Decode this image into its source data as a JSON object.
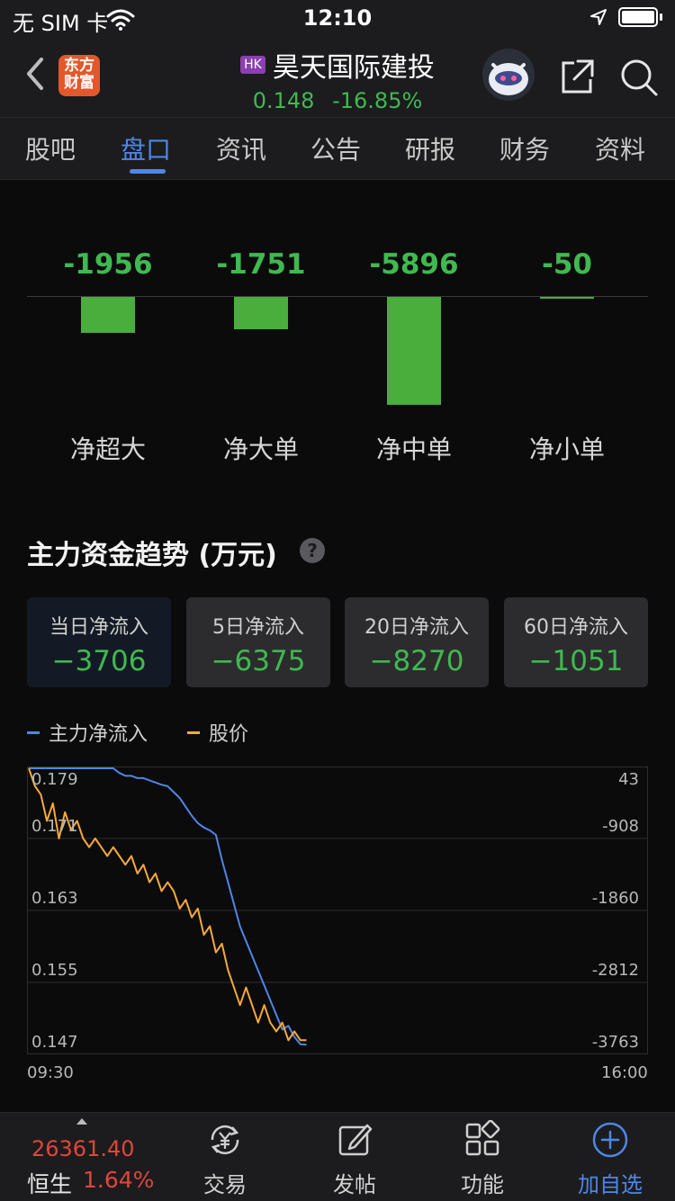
{
  "status_bar": {
    "carrier": "无 SIM 卡",
    "time": "12:10"
  },
  "header": {
    "logo_line1": "东方",
    "logo_line2": "财富",
    "market_badge": "HK",
    "stock_name": "昊天国际建投",
    "price": "0.148",
    "change_pct": "-16.85%"
  },
  "tabs": [
    {
      "label": "股吧"
    },
    {
      "label": "盘口",
      "active": true
    },
    {
      "label": "资讯"
    },
    {
      "label": "公告"
    },
    {
      "label": "研报"
    },
    {
      "label": "财务"
    },
    {
      "label": "资料"
    }
  ],
  "order_flow": {
    "items": [
      {
        "label": "净超大",
        "value": "-1956",
        "num": -1956
      },
      {
        "label": "净大单",
        "value": "-1751",
        "num": -1751
      },
      {
        "label": "净中单",
        "value": "-5896",
        "num": -5896
      },
      {
        "label": "净小单",
        "value": "-50",
        "num": -50
      }
    ]
  },
  "trend": {
    "title": "主力资金趋势 (万元)",
    "help": "?",
    "cards": [
      {
        "label": "当日净流入",
        "value": "−3706",
        "active": true
      },
      {
        "label": "5日净流入",
        "value": "−6375"
      },
      {
        "label": "20日净流入",
        "value": "−8270"
      },
      {
        "label": "60日净流入",
        "value": "−1051"
      }
    ],
    "legend": [
      {
        "label": "主力净流入",
        "color": "#4e86e8"
      },
      {
        "label": "股价",
        "color": "#f5a93b"
      }
    ]
  },
  "chart_data": {
    "type": "line",
    "x_start": "09:30",
    "x_end": "16:00",
    "y_left_ticks": [
      "0.179",
      "0.171",
      "0.163",
      "0.155",
      "0.147"
    ],
    "y_right_ticks": [
      "43",
      "-908",
      "-1860",
      "-2812",
      "-3763"
    ],
    "y_left_range": [
      0.147,
      0.179
    ],
    "y_right_range": [
      -3763,
      43
    ],
    "x_progress_end": 0.45,
    "series": [
      {
        "name": "主力净流入",
        "color": "#4e86e8",
        "axis": "right",
        "values": [
          43,
          43,
          43,
          43,
          43,
          43,
          43,
          43,
          43,
          43,
          43,
          43,
          43,
          43,
          43,
          -20,
          -60,
          -60,
          -90,
          -90,
          -120,
          -150,
          -180,
          -200,
          -280,
          -360,
          -480,
          -600,
          -700,
          -760,
          -800,
          -860,
          -1200,
          -1500,
          -1800,
          -2100,
          -2300,
          -2500,
          -2700,
          -2900,
          -3100,
          -3300,
          -3500,
          -3450,
          -3600,
          -3700,
          -3706
        ]
      },
      {
        "name": "股价",
        "color": "#f5a93b",
        "axis": "left",
        "values": [
          0.179,
          0.177,
          0.176,
          0.173,
          0.175,
          0.171,
          0.174,
          0.172,
          0.173,
          0.171,
          0.17,
          0.171,
          0.17,
          0.169,
          0.17,
          0.169,
          0.168,
          0.169,
          0.167,
          0.168,
          0.166,
          0.167,
          0.165,
          0.166,
          0.165,
          0.163,
          0.164,
          0.162,
          0.163,
          0.16,
          0.161,
          0.158,
          0.159,
          0.156,
          0.154,
          0.152,
          0.154,
          0.152,
          0.15,
          0.152,
          0.15,
          0.149,
          0.15,
          0.148,
          0.149,
          0.148,
          0.148
        ]
      }
    ]
  },
  "bottom_bar": {
    "index_value": "26361.40",
    "index_name": "恒生",
    "index_change": "1.64%",
    "items": [
      {
        "label": "交易",
        "icon": "yuan-cycle-icon"
      },
      {
        "label": "发帖",
        "icon": "edit-icon"
      },
      {
        "label": "功能",
        "icon": "grid-icon"
      },
      {
        "label": "加自选",
        "icon": "add-circle-icon",
        "accent": true
      }
    ]
  }
}
